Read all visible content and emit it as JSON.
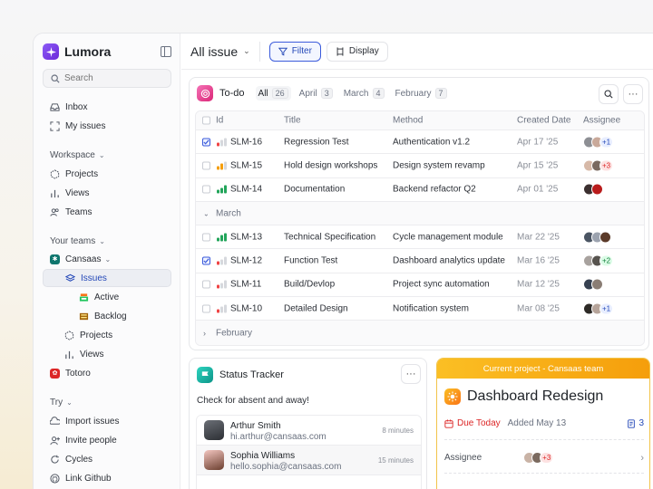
{
  "app": {
    "name": "Lumora"
  },
  "search": {
    "placeholder": "Search"
  },
  "nav": {
    "inbox": "Inbox",
    "my_issues": "My issues"
  },
  "workspace": {
    "label": "Workspace",
    "items": [
      "Projects",
      "Views",
      "Teams"
    ]
  },
  "your_teams": {
    "label": "Your teams",
    "team": "Cansaas",
    "issues": "Issues",
    "active": "Active",
    "backlog": "Backlog",
    "projects": "Projects",
    "views": "Views",
    "other_team": "Totoro"
  },
  "try": {
    "label": "Try",
    "items": [
      "Import issues",
      "Invite people",
      "Cycles",
      "Link Github"
    ]
  },
  "header": {
    "title": "All issue",
    "filter": "Filter",
    "display": "Display"
  },
  "todo": {
    "title": "To-do",
    "tabs": [
      {
        "label": "All",
        "count": "26"
      },
      {
        "label": "April",
        "count": "3"
      },
      {
        "label": "March",
        "count": "4"
      },
      {
        "label": "February",
        "count": "7"
      }
    ],
    "columns": {
      "id": "Id",
      "title": "Title",
      "method": "Method",
      "created": "Created Date",
      "assignee": "Assignee"
    },
    "rows": [
      {
        "id": "SLM-16",
        "title": "Regression Test",
        "method": "Authentication v1.2",
        "date": "Apr 17 '25",
        "more": "+1",
        "checked": true,
        "priority": "low"
      },
      {
        "id": "SLM-15",
        "title": "Hold design workshops",
        "method": "Design system revamp",
        "date": "Apr 15 '25",
        "more": "+3",
        "checked": false,
        "priority": "medium"
      },
      {
        "id": "SLM-14",
        "title": "Documentation",
        "method": "Backend refactor Q2",
        "date": "Apr 01 '25",
        "more": "",
        "checked": false,
        "priority": "high"
      },
      {
        "id": "SLM-13",
        "title": "Technical Specification",
        "method": "Cycle management module",
        "date": "Mar 22 '25",
        "more": "",
        "checked": false,
        "priority": "high"
      },
      {
        "id": "SLM-12",
        "title": "Function Test",
        "method": "Dashboard analytics update",
        "date": "Mar 16 '25",
        "more": "+2",
        "checked": true,
        "priority": "low"
      },
      {
        "id": "SLM-11",
        "title": "Build/Devlop",
        "method": "Project sync automation",
        "date": "Mar 12 '25",
        "more": "",
        "checked": false,
        "priority": "low"
      },
      {
        "id": "SLM-10",
        "title": "Detailed Design",
        "method": "Notification system",
        "date": "Mar 08 '25",
        "more": "+1",
        "checked": false,
        "priority": "low"
      }
    ],
    "groups": {
      "march": "March",
      "february": "February"
    }
  },
  "status": {
    "title": "Status Tracker",
    "subtitle": "Check for absent and away!",
    "people": [
      {
        "name": "Arthur Smith",
        "email": "hi.arthur@cansaas.com",
        "time": "8 minutes"
      },
      {
        "name": "Sophia Williams",
        "email": "hello.sophia@cansaas.com",
        "time": "15 minutes"
      }
    ]
  },
  "project": {
    "banner": "Current project - Cansaas team",
    "title": "Dashboard Redesign",
    "due": "Due Today",
    "added": "Added May 13",
    "issues": "3",
    "assignee_label": "Assignee",
    "assignee_more": "+3"
  },
  "colors": {
    "accent": "#3b5bdb",
    "todo_icon": "#db2777",
    "status_icon": "#0d9488",
    "project_banner": "#f59e0b",
    "danger": "#dc2626"
  }
}
